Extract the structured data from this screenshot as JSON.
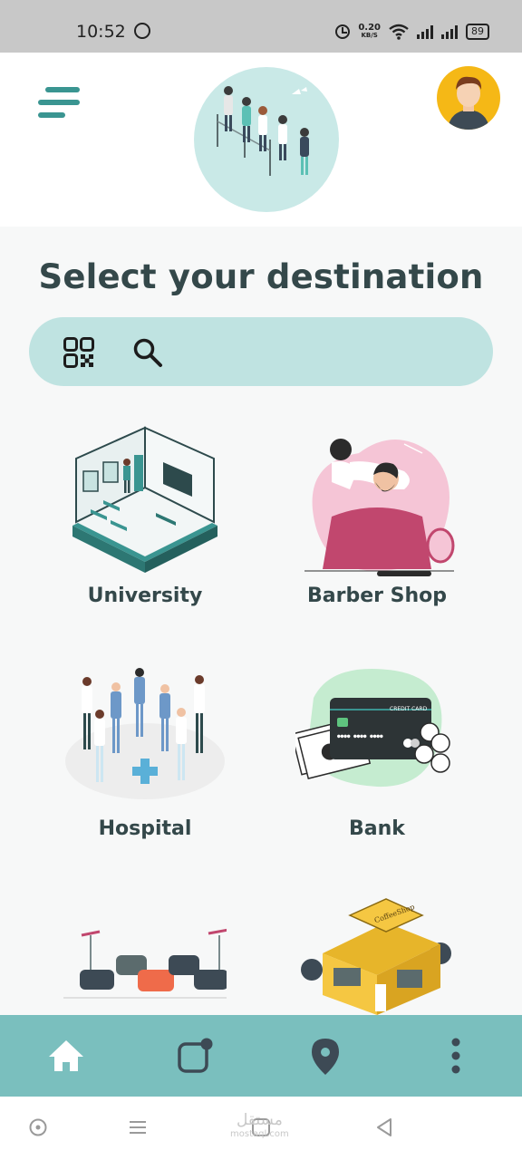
{
  "status_bar": {
    "time": "10:52",
    "net_speed_value": "0.20",
    "net_speed_unit": "KB/S",
    "battery": "89",
    "icons": [
      "whatsapp-icon",
      "alarm-icon",
      "wifi-icon",
      "signal-icon",
      "signal-icon",
      "battery-icon"
    ]
  },
  "header": {
    "menu_icon": "hamburger-menu-icon",
    "hero_image": "people-queue-illustration",
    "avatar_image": "user-avatar"
  },
  "page": {
    "title": "Select your destination"
  },
  "search": {
    "icons": [
      "qr-code-icon",
      "search-icon"
    ]
  },
  "destinations": [
    {
      "label": "University",
      "image": "university-classroom-illustration"
    },
    {
      "label": "Barber Shop",
      "image": "barber-shop-illustration"
    },
    {
      "label": "Hospital",
      "image": "hospital-staff-illustration"
    },
    {
      "label": "Bank",
      "image": "bank-credit-card-illustration"
    },
    {
      "label": "",
      "image": "parking-cars-illustration"
    },
    {
      "label": "",
      "image": "coffee-shop-illustration"
    }
  ],
  "coffee_sign": "CoffeeShop",
  "card_text": "CREDIT CARD",
  "bottom_nav": {
    "items": [
      "home-icon",
      "notification-square-icon",
      "location-pin-icon",
      "more-vertical-icon"
    ]
  },
  "system_nav": {
    "watermark_ar": "مستقل",
    "watermark_en": "mostaql.com"
  },
  "colors": {
    "teal": "#3a9591",
    "search_bg": "#bfe3e1",
    "nav_bg": "#7abfbe",
    "title": "#34484a"
  }
}
